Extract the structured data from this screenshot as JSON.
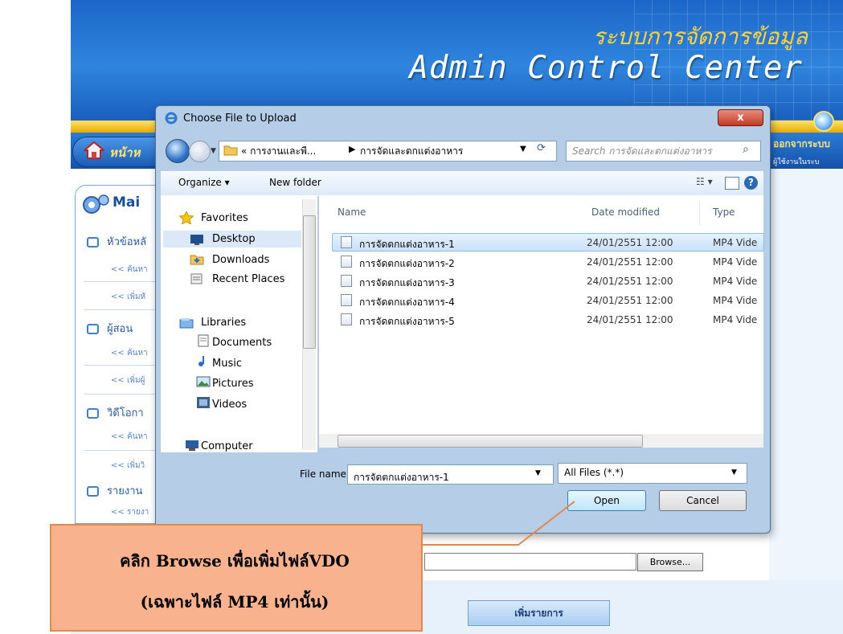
{
  "banner": {
    "thai_title": "ระบบการจัดการข้อมูล",
    "title": "Admin Control Center"
  },
  "nav": {
    "home_label": "หน้าห",
    "logout_label": "ออกจากระบบ",
    "user_label": "ผู้ใช้งานในระบ"
  },
  "sidebar": {
    "header": "Mai",
    "items": [
      {
        "label": "หัวข้อหลั"
      },
      {
        "label": "ค้นหา"
      },
      {
        "label": "เพิ่มหั"
      },
      {
        "label": "ผู้สอน"
      },
      {
        "label": "ค้นหา"
      },
      {
        "label": "เพิ่มผู้"
      },
      {
        "label": "วิดีโอกา"
      },
      {
        "label": "ค้นหา"
      },
      {
        "label": "เพิ่มวิ"
      },
      {
        "label": "รายงาน"
      },
      {
        "label": "รายงา"
      }
    ]
  },
  "page": {
    "browse_label": "Browse...",
    "add_button": "เพิ่มรายการ"
  },
  "dialog": {
    "title": "Choose File to Upload",
    "close_label": "x",
    "address": {
      "crumb1": "« การงานและพื...",
      "sep": "▶",
      "crumb2": "การจัดและตกแต่งอาหาร"
    },
    "search_placeholder": "Search การจัดและตกแต่งอาหาร",
    "toolbar": {
      "organize": "Organize ▾",
      "new_folder": "New folder",
      "help": "?"
    },
    "nav_pane": {
      "favorites": "Favorites",
      "desktop": "Desktop",
      "downloads": "Downloads",
      "recent": "Recent Places",
      "libraries": "Libraries",
      "documents": "Documents",
      "music": "Music",
      "pictures": "Pictures",
      "videos": "Videos",
      "computer": "Computer"
    },
    "columns": {
      "name": "Name",
      "date": "Date modified",
      "type": "Type"
    },
    "files": [
      {
        "name": "การจัดตกแต่งอาหาร-1",
        "date": "24/01/2551 12:00",
        "type": "MP4 Vide"
      },
      {
        "name": "การจัดตกแต่งอาหาร-2",
        "date": "24/01/2551 12:00",
        "type": "MP4 Vide"
      },
      {
        "name": "การจัดตกแต่งอาหาร-3",
        "date": "24/01/2551 12:00",
        "type": "MP4 Vide"
      },
      {
        "name": "การจัดตกแต่งอาหาร-4",
        "date": "24/01/2551 12:00",
        "type": "MP4 Vide"
      },
      {
        "name": "การจัดตกแต่งอาหาร-5",
        "date": "24/01/2551 12:00",
        "type": "MP4 Vide"
      }
    ],
    "file_name_label": "File name:",
    "file_name_value": "การจัดตกแต่งอาหาร-1",
    "file_type_value": "All Files (*.*)",
    "open_label": "Open",
    "cancel_label": "Cancel"
  },
  "callout": {
    "line1": "คลิก Browse เพื่อเพิ่มไฟล์VDO",
    "line2": "(เฉพาะไฟล์ MP4 เท่านั้น)"
  },
  "colors": {
    "banner": "#1c66c9",
    "gold": "#e9a800",
    "callout": "#f8b28e",
    "selection": "#c9e1fa"
  }
}
